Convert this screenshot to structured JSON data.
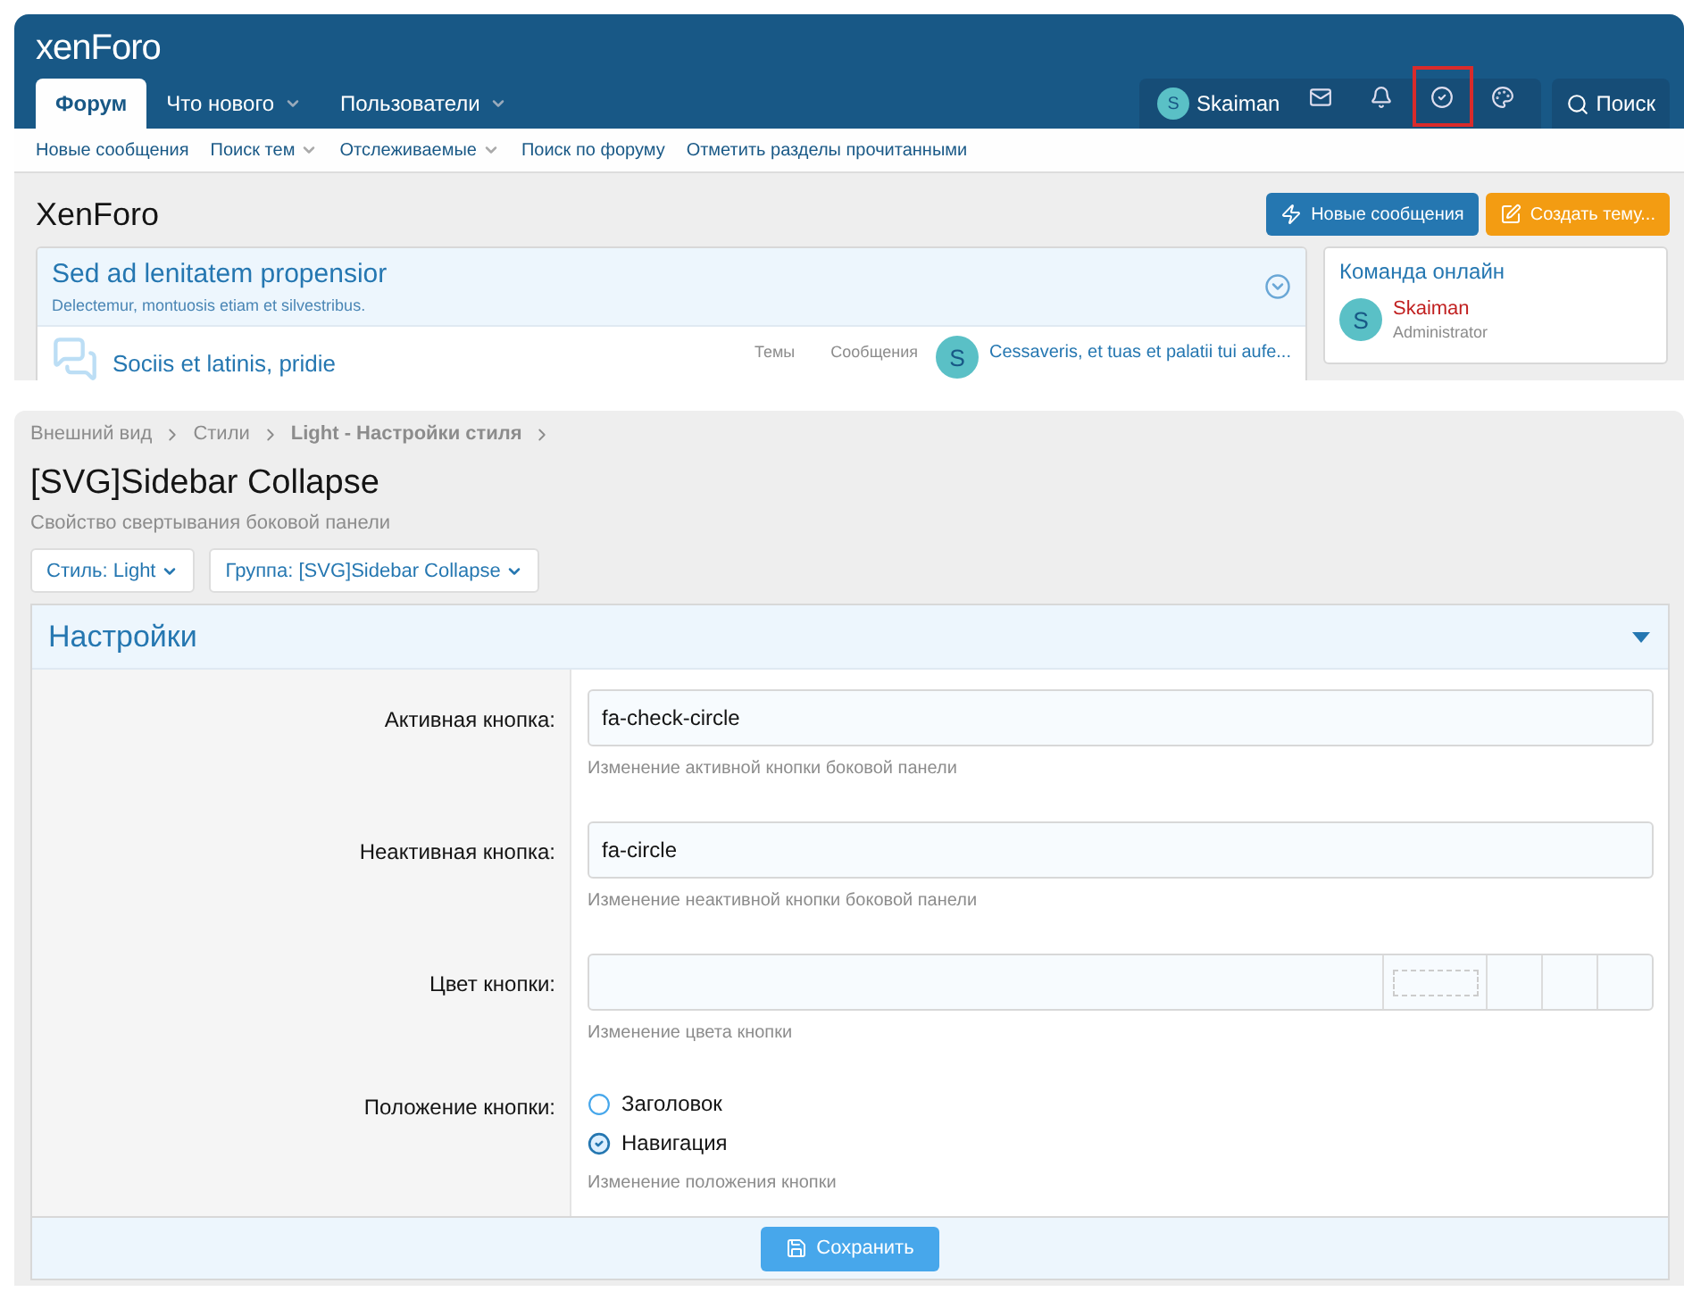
{
  "forum": {
    "logo": "xenForo",
    "tabs": [
      {
        "label": "Форум",
        "selected": true,
        "dropdown": false
      },
      {
        "label": "Что нового",
        "selected": false,
        "dropdown": true
      },
      {
        "label": "Пользователи",
        "selected": false,
        "dropdown": true
      }
    ],
    "user": {
      "avatar": "S",
      "name": "Skaiman"
    },
    "toolbar": [
      {
        "kind": "mail",
        "highlighted": false
      },
      {
        "kind": "bell",
        "highlighted": false
      },
      {
        "kind": "check",
        "highlighted": true
      },
      {
        "kind": "palette",
        "highlighted": false
      }
    ],
    "search": "Поиск",
    "subnav": [
      {
        "label": "Новые сообщения",
        "dropdown": false
      },
      {
        "label": "Поиск тем",
        "dropdown": true
      },
      {
        "label": "Отслеживаемые",
        "dropdown": true
      },
      {
        "label": "Поиск по форуму",
        "dropdown": false
      },
      {
        "label": "Отметить разделы прочитанными",
        "dropdown": false
      }
    ],
    "title": "XenForo",
    "buttons": [
      {
        "kind": "new",
        "label": "Новые сообщения"
      },
      {
        "kind": "create",
        "label": "Создать тему..."
      }
    ],
    "category": {
      "title": "Sed ad lenitatem propensior",
      "description": "Delectemur, montuosis etiam et silvestribus.",
      "forum": {
        "title": "Sociis et latinis, pridie",
        "stats": [
          "Темы",
          "Сообщения"
        ],
        "avatar": "S",
        "last": "Cessaveris, et tuas et palatii tui aufe..."
      }
    },
    "sidebar": {
      "title": "Команда онлайн",
      "avatar": "S",
      "name": "Skaiman",
      "role": "Administrator"
    }
  },
  "admin": {
    "breadcrumbs": [
      {
        "label": "Внешний вид",
        "bold": false
      },
      {
        "label": "Стили",
        "bold": false
      },
      {
        "label": "Light - Настройки стиля",
        "bold": true
      }
    ],
    "title": "[SVG]Sidebar Collapse",
    "description": "Свойство свертывания боковой панели",
    "filters": [
      "Стиль: Light",
      "Группа: [SVG]Sidebar Collapse"
    ],
    "section": "Настройки",
    "fields": [
      {
        "kind": "text",
        "label": "Активная кнопка:",
        "value": "fa-check-circle",
        "hint": "Изменение активной кнопки боковой панели"
      },
      {
        "kind": "text",
        "label": "Неактивная кнопка:",
        "value": "fa-circle",
        "hint": "Изменение неактивной кнопки боковой панели"
      },
      {
        "kind": "color",
        "label": "Цвет кнопки:",
        "hint": "Изменение цвета кнопки"
      },
      {
        "kind": "radio",
        "label": "Положение кнопки:",
        "hint": "Изменение положения кнопки",
        "options": [
          {
            "label": "Заголовок",
            "selected": false
          },
          {
            "label": "Навигация",
            "selected": true
          }
        ]
      }
    ],
    "save": "Сохранить"
  }
}
